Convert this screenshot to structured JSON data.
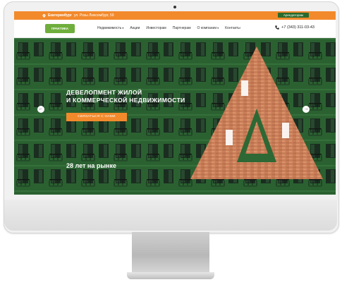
{
  "topbar": {
    "city": "Екатеринбург",
    "address": "ул. Розы Люксембург, 59",
    "rent_button": "Арендаторам"
  },
  "navbar": {
    "logo_text": "ПРАКТИКА",
    "links": [
      "Недвижимость",
      "Акции",
      "Инвесторам",
      "Партнерам",
      "О компании",
      "Контакты"
    ],
    "phone": "+7 (343) 311-03-43"
  },
  "hero": {
    "title_line1": "ДЕВЕЛОПМЕНТ ЖИЛОЙ",
    "title_line2": "И КОММЕРЧЕСКОЙ НЕДВИЖИМОСТИ",
    "cta": "СВЯЗАТЬСЯ С НАМИ",
    "years": "28 лет на рынке",
    "prev_arrow": "←",
    "next_arrow": "→"
  },
  "colors": {
    "accent_orange": "#f28a2c",
    "brand_green": "#2a6a2c",
    "facade_green": "#2f6a35",
    "brick": "#c97e58"
  },
  "icons": {
    "location": "map-pin-icon",
    "phone": "phone-icon",
    "dropdown": "chevron-down-icon",
    "prev": "arrow-left-icon",
    "next": "arrow-right-icon"
  }
}
